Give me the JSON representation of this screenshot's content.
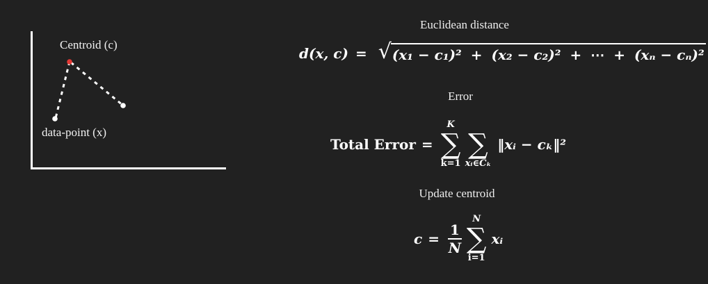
{
  "diagram": {
    "centroid_label": "Centroid (c)",
    "datapoint_label": "data-point (x)",
    "colors": {
      "centroid": "#e53935",
      "point": "#ffffff",
      "axes": "#ffffff"
    }
  },
  "formulas": {
    "euclidean": {
      "title": "Euclidean distance",
      "lhs": "d(x, c)",
      "equals": "=",
      "term1": "(x₁ − c₁)²",
      "term2": "(x₂ − c₂)²",
      "ellipsis": "⋯",
      "termn": "(xₙ − cₙ)²",
      "plus": "+"
    },
    "error": {
      "title": "Error",
      "lhs": "Total Error",
      "equals": "=",
      "sum1_top": "K",
      "sum1_bottom": "k=1",
      "sum2_bottom": "xᵢ∈Cₖ",
      "sigma": "∑",
      "body": "‖xᵢ − cₖ‖²"
    },
    "update": {
      "title": "Update centroid",
      "lhs": "c",
      "equals": "=",
      "numerator": "1",
      "denominator": "N",
      "sum_top": "N",
      "sum_bottom": "i=1",
      "sigma": "∑",
      "body": "xᵢ"
    }
  }
}
